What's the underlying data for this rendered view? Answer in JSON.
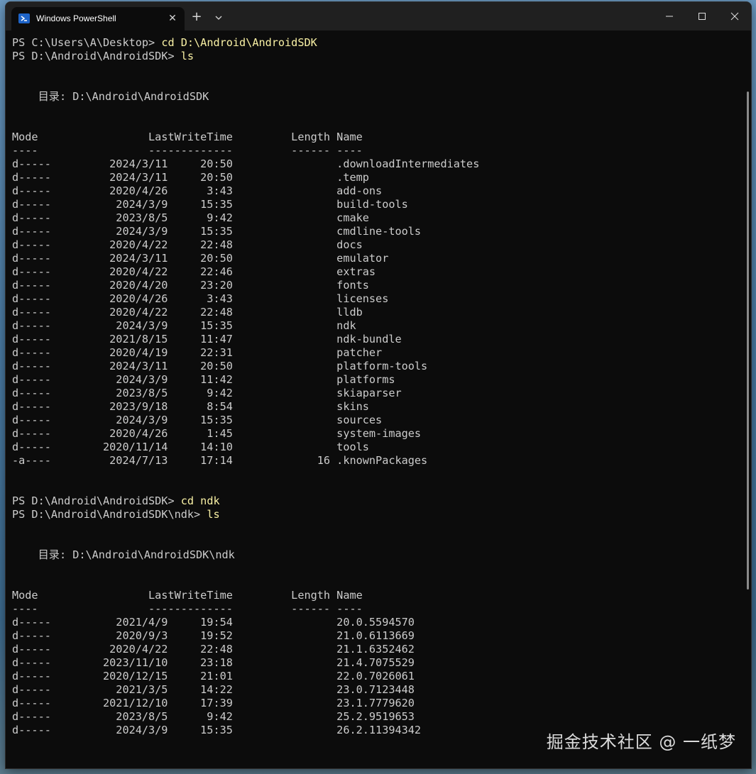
{
  "window": {
    "tab_title": "Windows PowerShell",
    "tab_close": "✕",
    "new_tab": "+",
    "icons": {
      "tab": "powershell-icon",
      "dropdown": "chevron-down-icon",
      "minimize": "minimize-icon",
      "maximize": "maximize-icon",
      "close": "close-icon"
    }
  },
  "terminal": {
    "lines": [
      {
        "prompt": "PS C:\\Users\\A\\Desktop> ",
        "cmd": "cd D:\\Android\\AndroidSDK"
      },
      {
        "prompt": "PS D:\\Android\\AndroidSDK> ",
        "cmd": "ls"
      },
      {
        "text": ""
      },
      {
        "text": ""
      },
      {
        "text": "    目录: D:\\Android\\AndroidSDK"
      },
      {
        "text": ""
      },
      {
        "text": ""
      },
      {
        "text": "Mode                 LastWriteTime         Length Name"
      },
      {
        "text": "----                 -------------         ------ ----"
      },
      {
        "text": "d-----         2024/3/11     20:50                .downloadIntermediates"
      },
      {
        "text": "d-----         2024/3/11     20:50                .temp"
      },
      {
        "text": "d-----         2020/4/26      3:43                add-ons"
      },
      {
        "text": "d-----          2024/3/9     15:35                build-tools"
      },
      {
        "text": "d-----          2023/8/5      9:42                cmake"
      },
      {
        "text": "d-----          2024/3/9     15:35                cmdline-tools"
      },
      {
        "text": "d-----         2020/4/22     22:48                docs"
      },
      {
        "text": "d-----         2024/3/11     20:50                emulator"
      },
      {
        "text": "d-----         2020/4/22     22:46                extras"
      },
      {
        "text": "d-----         2020/4/20     23:20                fonts"
      },
      {
        "text": "d-----         2020/4/26      3:43                licenses"
      },
      {
        "text": "d-----         2020/4/22     22:48                lldb"
      },
      {
        "text": "d-----          2024/3/9     15:35                ndk"
      },
      {
        "text": "d-----         2021/8/15     11:47                ndk-bundle"
      },
      {
        "text": "d-----         2020/4/19     22:31                patcher"
      },
      {
        "text": "d-----         2024/3/11     20:50                platform-tools"
      },
      {
        "text": "d-----          2024/3/9     11:42                platforms"
      },
      {
        "text": "d-----          2023/8/5      9:42                skiaparser"
      },
      {
        "text": "d-----         2023/9/18      8:54                skins"
      },
      {
        "text": "d-----          2024/3/9     15:35                sources"
      },
      {
        "text": "d-----         2020/4/26      1:45                system-images"
      },
      {
        "text": "d-----        2020/11/14     14:10                tools"
      },
      {
        "text": "-a----         2024/7/13     17:14             16 .knownPackages"
      },
      {
        "text": ""
      },
      {
        "text": ""
      },
      {
        "prompt": "PS D:\\Android\\AndroidSDK> ",
        "cmd": "cd ndk"
      },
      {
        "prompt": "PS D:\\Android\\AndroidSDK\\ndk> ",
        "cmd": "ls"
      },
      {
        "text": ""
      },
      {
        "text": ""
      },
      {
        "text": "    目录: D:\\Android\\AndroidSDK\\ndk"
      },
      {
        "text": ""
      },
      {
        "text": ""
      },
      {
        "text": "Mode                 LastWriteTime         Length Name"
      },
      {
        "text": "----                 -------------         ------ ----"
      },
      {
        "text": "d-----          2021/4/9     19:54                20.0.5594570"
      },
      {
        "text": "d-----          2020/9/3     19:52                21.0.6113669"
      },
      {
        "text": "d-----         2020/4/22     22:48                21.1.6352462"
      },
      {
        "text": "d-----        2023/11/10     23:18                21.4.7075529"
      },
      {
        "text": "d-----        2020/12/15     21:01                22.0.7026061"
      },
      {
        "text": "d-----          2021/3/5     14:22                23.0.7123448"
      },
      {
        "text": "d-----        2021/12/10     17:39                23.1.7779620"
      },
      {
        "text": "d-----          2023/8/5      9:42                25.2.9519653"
      },
      {
        "text": "d-----          2024/3/9     15:35                26.2.11394342"
      }
    ]
  },
  "watermark": "掘金技术社区 @ 一纸梦"
}
